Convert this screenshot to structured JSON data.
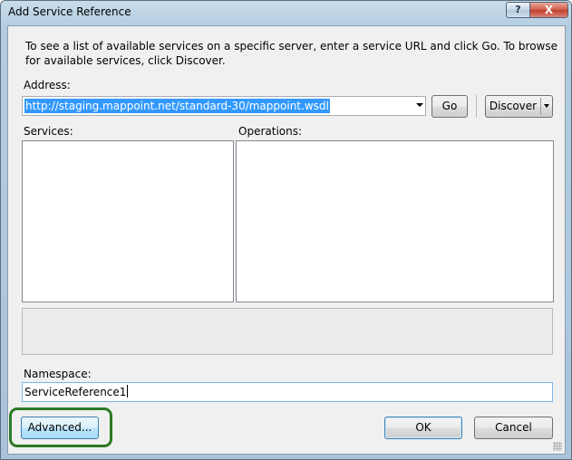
{
  "window": {
    "title": "Add Service Reference",
    "help_label": "?",
    "close_label": "X"
  },
  "description": "To see a list of available services on a specific server, enter a service URL and click Go. To browse for available services, click Discover.",
  "address": {
    "label": "Address:",
    "value": "http://staging.mappoint.net/standard-30/mappoint.wsdl"
  },
  "buttons": {
    "go": "Go",
    "discover": "Discover",
    "advanced": "Advanced...",
    "ok": "OK",
    "cancel": "Cancel"
  },
  "services": {
    "label": "Services:"
  },
  "operations": {
    "label": "Operations:"
  },
  "namespace": {
    "label": "Namespace:",
    "value": "ServiceReference1"
  },
  "colors": {
    "highlight_ring": "#2a7a24",
    "selection": "#3399ff"
  }
}
